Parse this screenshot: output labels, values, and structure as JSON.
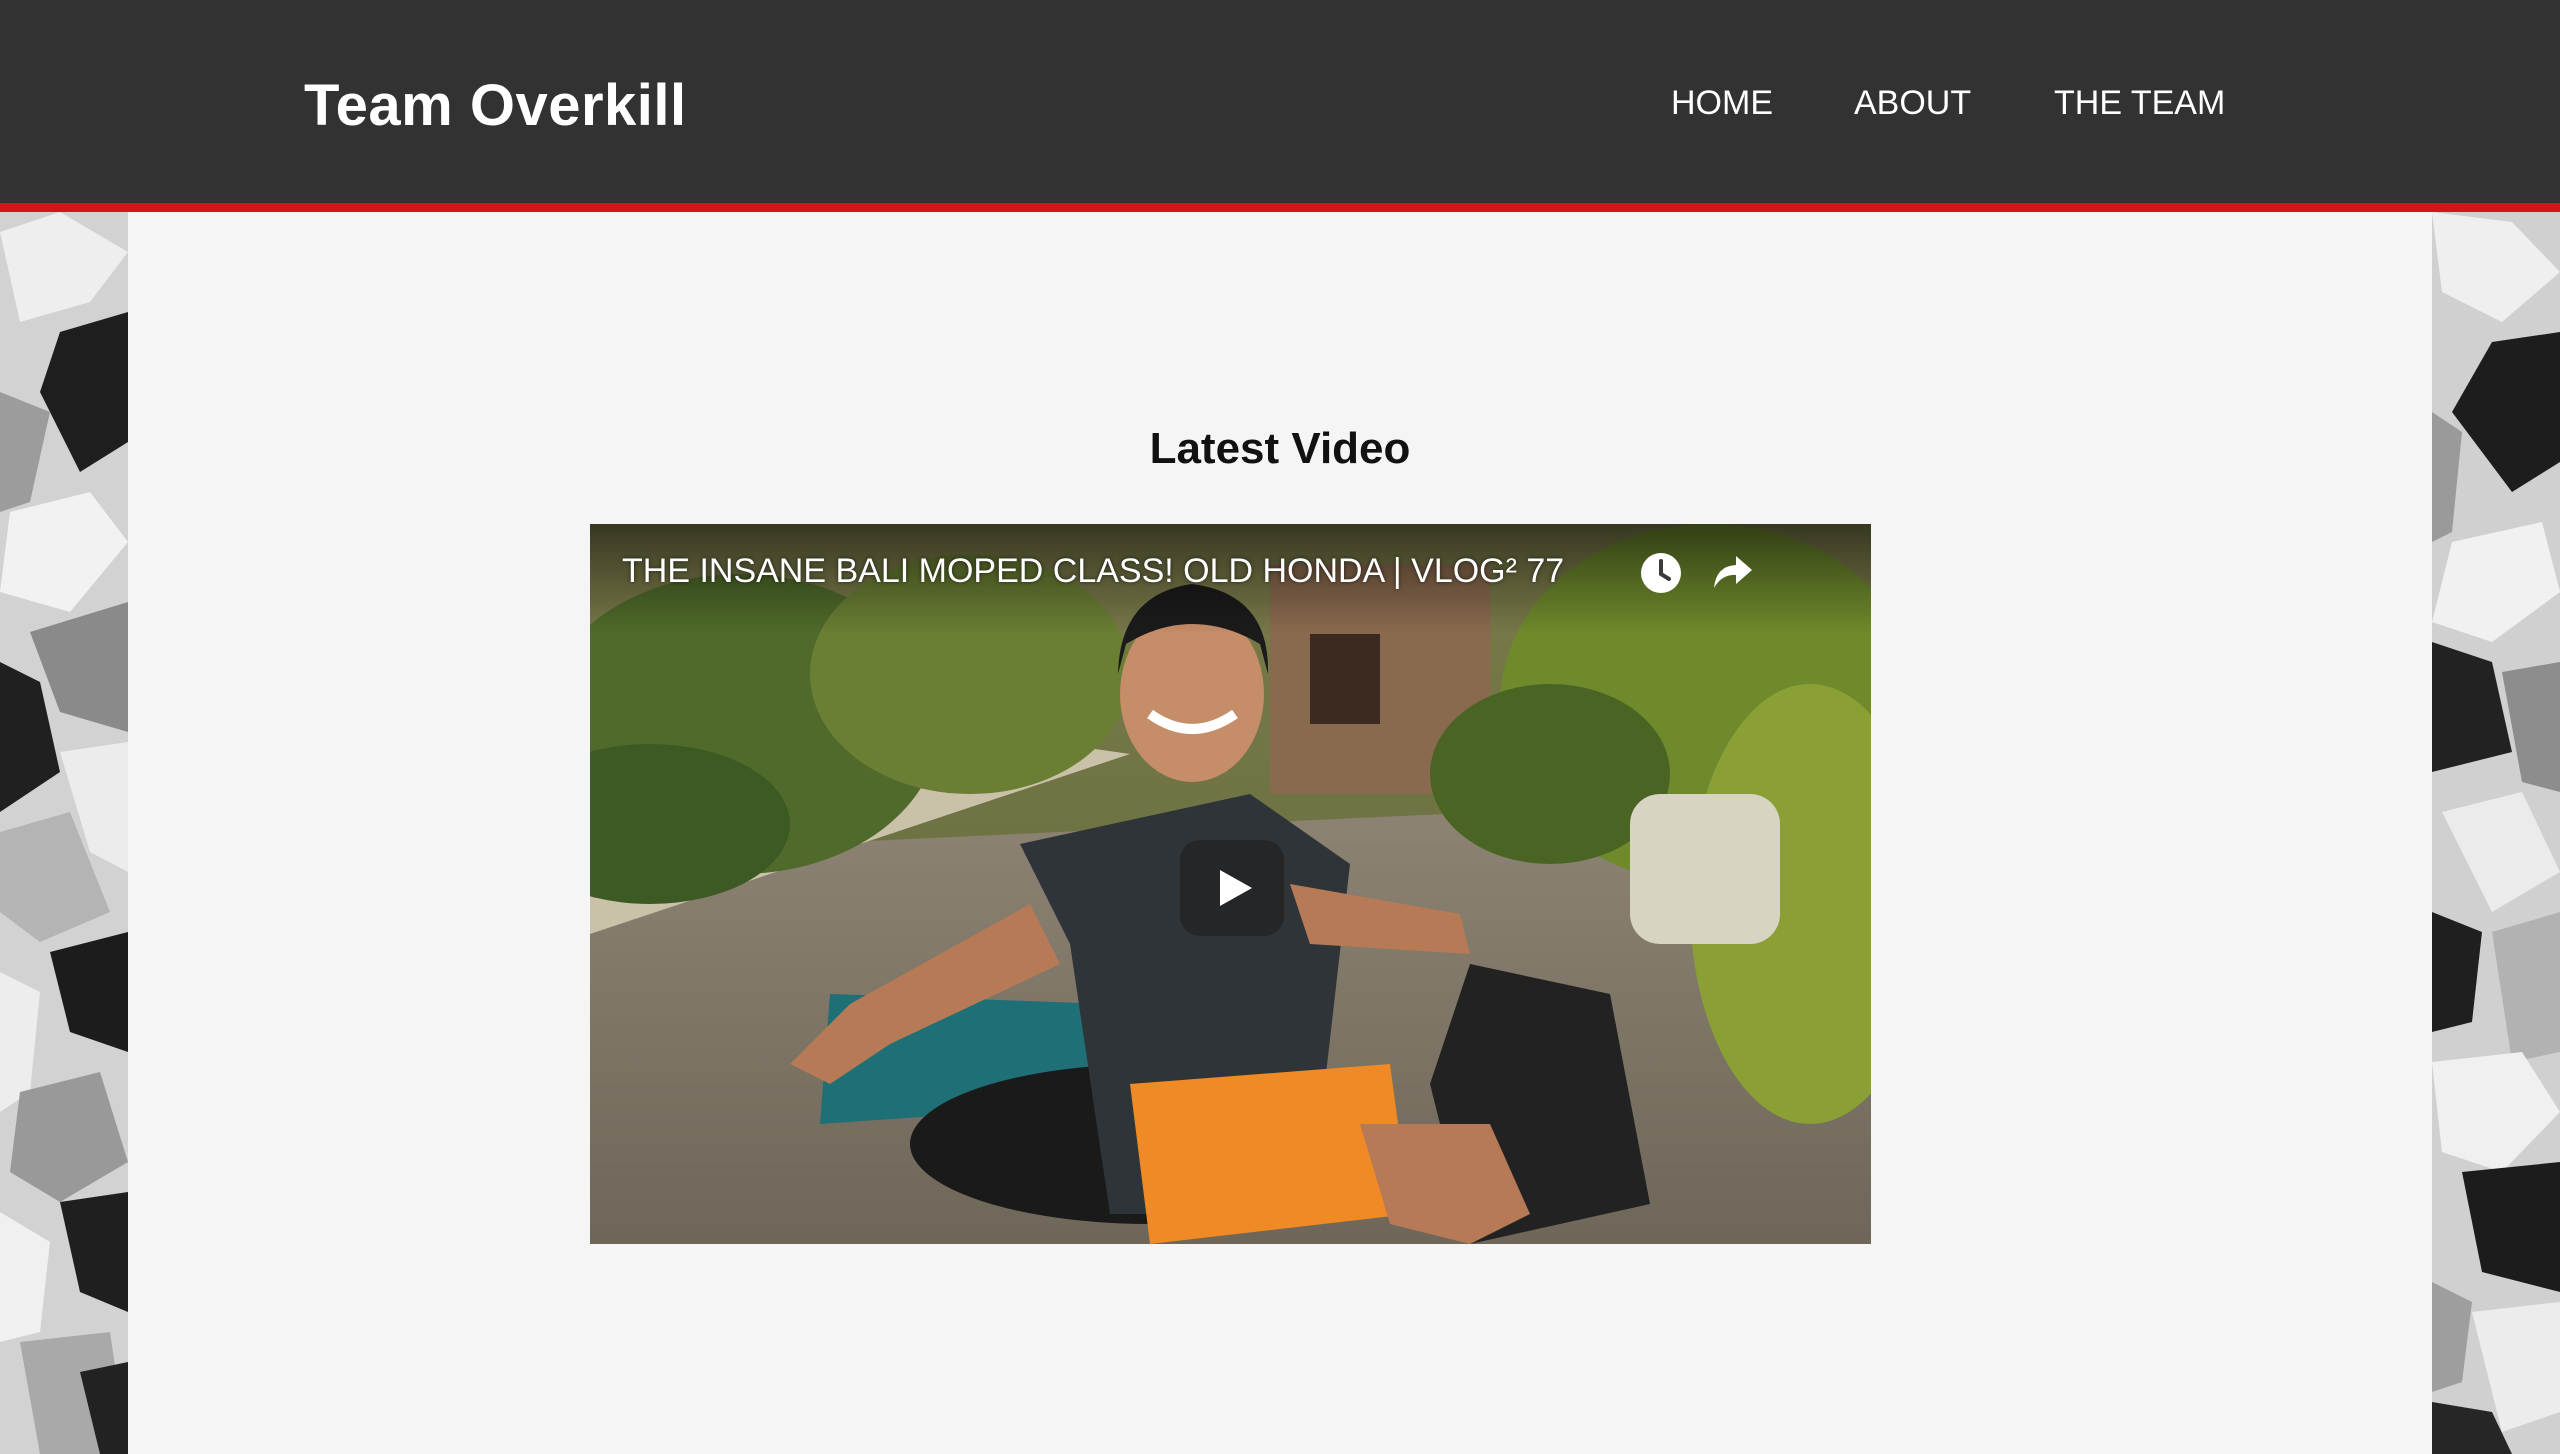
{
  "header": {
    "brand": "Team Overkill",
    "nav": [
      {
        "label": "HOME"
      },
      {
        "label": "ABOUT"
      },
      {
        "label": "THE TEAM"
      }
    ]
  },
  "main": {
    "section_title": "Latest Video",
    "video": {
      "title": "THE INSANE BALI MOPED CLASS! OLD HONDA | VLOG² 77",
      "watch_later_icon": "clock-icon",
      "share_icon": "share-arrow-icon",
      "play_icon": "play-icon"
    }
  },
  "colors": {
    "header_bg": "#323232",
    "accent_red": "#d4141b",
    "page_bg": "#f5f5f5",
    "text_dark": "#111111",
    "nav_text": "#ffffff"
  }
}
